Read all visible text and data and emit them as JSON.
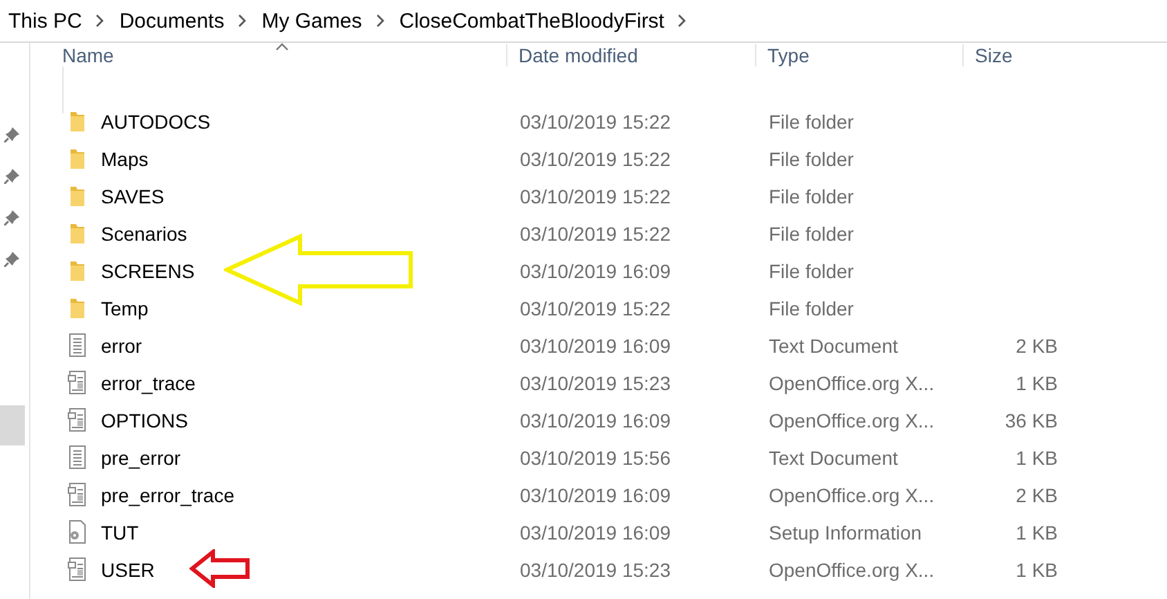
{
  "breadcrumb": [
    "This PC",
    "Documents",
    "My Games",
    "CloseCombatTheBloodyFirst"
  ],
  "columns": [
    {
      "label": "Name",
      "sorted": true
    },
    {
      "label": "Date modified",
      "sorted": false
    },
    {
      "label": "Type",
      "sorted": false
    },
    {
      "label": "Size",
      "sorted": false
    }
  ],
  "rows": [
    {
      "kind": "folder",
      "name": "AUTODOCS",
      "date": "03/10/2019 15:22",
      "type": "File folder"
    },
    {
      "kind": "folder",
      "name": "Maps",
      "date": "03/10/2019 15:22",
      "type": "File folder"
    },
    {
      "kind": "folder",
      "name": "SAVES",
      "date": "03/10/2019 15:22",
      "type": "File folder"
    },
    {
      "kind": "folder",
      "name": "Scenarios",
      "date": "03/10/2019 15:22",
      "type": "File folder"
    },
    {
      "kind": "folder",
      "name": "SCREENS",
      "date": "03/10/2019 16:09",
      "type": "File folder",
      "arrow": {
        "kind": "large",
        "color": "#f5ef00"
      }
    },
    {
      "kind": "folder",
      "name": "Temp",
      "date": "03/10/2019 15:22",
      "type": "File folder"
    },
    {
      "kind": "text",
      "name": "error",
      "date": "03/10/2019 16:09",
      "type": "Text Document",
      "size": "2 KB"
    },
    {
      "kind": "document",
      "name": "error_trace",
      "date": "03/10/2019 15:23",
      "type": "OpenOffice.org X...",
      "size": "1 KB"
    },
    {
      "kind": "document",
      "name": "OPTIONS",
      "date": "03/10/2019 16:09",
      "type": "OpenOffice.org X...",
      "size": "36 KB"
    },
    {
      "kind": "text",
      "name": "pre_error",
      "date": "03/10/2019 15:56",
      "type": "Text Document",
      "size": "1 KB"
    },
    {
      "kind": "document",
      "name": "pre_error_trace",
      "date": "03/10/2019 16:09",
      "type": "OpenOffice.org X...",
      "size": "2 KB"
    },
    {
      "kind": "setup",
      "name": "TUT",
      "date": "03/10/2019 16:09",
      "type": "Setup Information",
      "size": "1 KB"
    },
    {
      "kind": "document",
      "name": "USER",
      "date": "03/10/2019 15:23",
      "type": "OpenOffice.org X...",
      "size": "1 KB",
      "arrow": {
        "kind": "small",
        "color": "#e0141e"
      }
    }
  ]
}
